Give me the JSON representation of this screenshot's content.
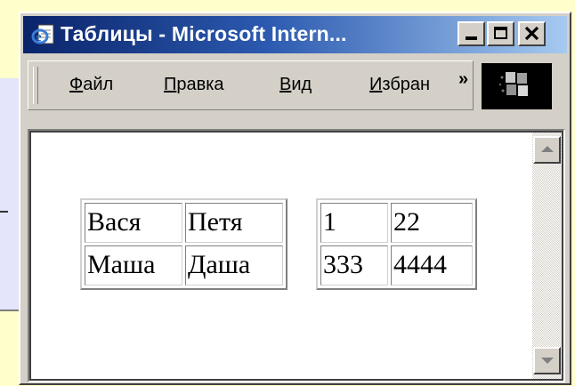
{
  "window": {
    "title": "Таблицы - Microsoft Intern..."
  },
  "menu": {
    "file": {
      "accel": "Ф",
      "rest": "айл"
    },
    "edit": {
      "accel": "П",
      "rest": "равка"
    },
    "view": {
      "accel": "В",
      "rest": "ид"
    },
    "favorites": {
      "accel": "И",
      "rest": "збран"
    },
    "more": "»"
  },
  "tables": {
    "names": [
      [
        "Вася",
        "Петя"
      ],
      [
        "Маша",
        "Даша"
      ]
    ],
    "numbers": [
      [
        "1",
        "22"
      ],
      [
        "333",
        "4444"
      ]
    ]
  },
  "icons": {
    "app": "ie-page-icon",
    "minimize": "minimize-icon",
    "maximize": "maximize-icon",
    "close": "close-icon",
    "logo": "windows-logo-icon",
    "scroll_up": "scroll-up-arrow-icon",
    "scroll_down": "scroll-down-arrow-icon"
  },
  "colors": {
    "title_start": "#0a246a",
    "title_end": "#a6caf0",
    "chrome": "#d4d0c8",
    "slide_bg": "#ffffcc",
    "slide_panel": "#e4e4fa"
  }
}
